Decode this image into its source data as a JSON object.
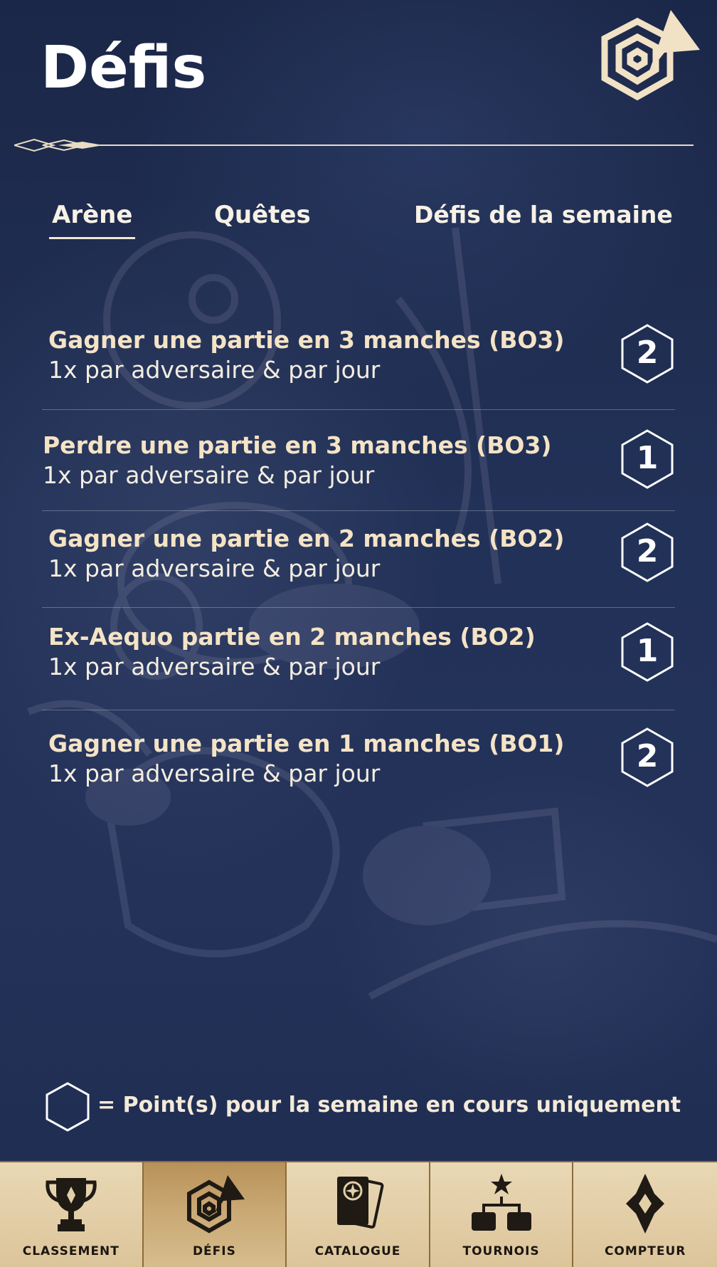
{
  "header": {
    "title": "Défis",
    "logo_icon": "challenge-logo-icon"
  },
  "tabs": [
    {
      "label": "Arène",
      "active": true
    },
    {
      "label": "Quêtes",
      "active": false
    },
    {
      "label": "Défis de la semaine",
      "active": false
    }
  ],
  "challenges": [
    {
      "title": "Gagner une partie en 3 manches (BO3)",
      "subtitle": "1x par adversaire & par jour",
      "points": "2"
    },
    {
      "title": "Perdre une partie en 3 manches (BO3)",
      "subtitle": "1x par adversaire & par jour",
      "points": "1"
    },
    {
      "title": "Gagner une partie en 2 manches (BO2)",
      "subtitle": "1x par adversaire & par jour",
      "points": "2"
    },
    {
      "title": "Ex-Aequo partie en 2 manches (BO2)",
      "subtitle": "1x par adversaire & par jour",
      "points": "1"
    },
    {
      "title": "Gagner une partie en 1 manches (BO1)",
      "subtitle": "1x par adversaire & par jour",
      "points": "2"
    }
  ],
  "legend": {
    "text": "= Point(s) pour la semaine en cours uniquement",
    "icon": "hexagon-icon"
  },
  "bottom_nav": [
    {
      "label": "CLASSEMENT",
      "icon": "trophy-icon",
      "active": false
    },
    {
      "label": "DÉFIS",
      "icon": "challenge-icon",
      "active": true
    },
    {
      "label": "CATALOGUE",
      "icon": "cards-icon",
      "active": false
    },
    {
      "label": "TOURNOIS",
      "icon": "bracket-icon",
      "active": false
    },
    {
      "label": "COMPTEUR",
      "icon": "diamond-counter-icon",
      "active": false
    }
  ],
  "colors": {
    "background": "#1f2d52",
    "accent_cream": "#f4e3c5",
    "nav_gold": "#dcc49a",
    "nav_active": "#c9a873"
  }
}
